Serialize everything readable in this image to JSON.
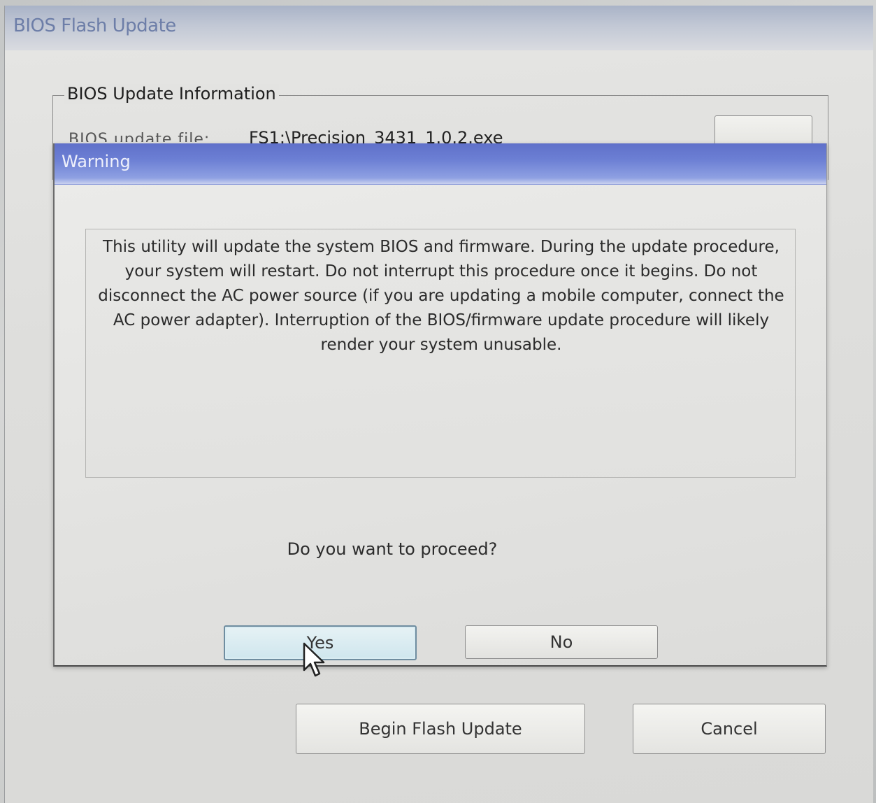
{
  "main_window": {
    "title": "BIOS Flash Update",
    "info_group": {
      "legend": "BIOS Update Information",
      "file_label": "BIOS update file:",
      "file_value": "FS1:\\Precision_3431_1.0.2.exe"
    },
    "buttons": {
      "begin": "Begin Flash Update",
      "cancel": "Cancel"
    }
  },
  "warning_dialog": {
    "title": "Warning",
    "message": "This utility will update the system BIOS and firmware.  During the update procedure, your system will restart. Do not interrupt this procedure once it begins.  Do not disconnect the AC power source (if you are updating a mobile computer, connect the AC power adapter).  Interruption of the BIOS/firmware update procedure will likely render your system unusable.",
    "prompt": "Do you want to proceed?",
    "buttons": {
      "yes": "Yes",
      "no": "No"
    }
  },
  "icons": {
    "cursor": "mouse-pointer-arrow"
  },
  "colors": {
    "warning_title_bar": "#6c7fd4",
    "main_title_text": "#6d7ea8",
    "yes_button_highlight": "#cfe6ee"
  }
}
